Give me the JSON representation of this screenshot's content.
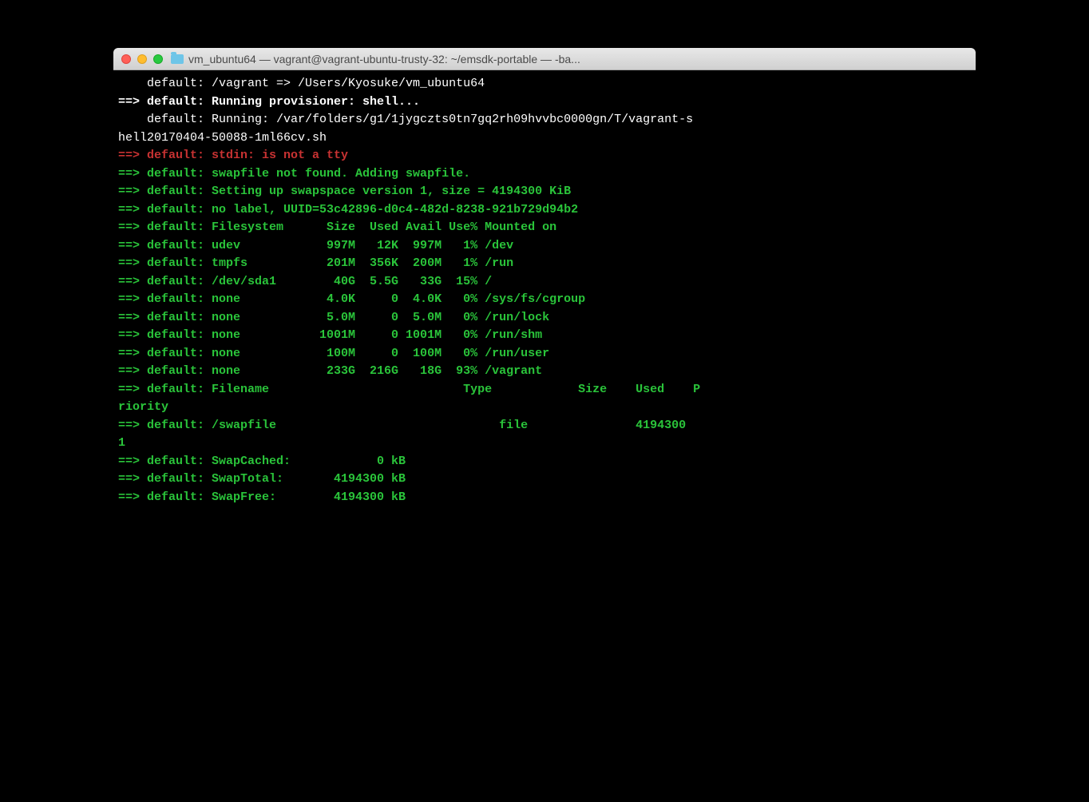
{
  "window": {
    "title": "vm_ubuntu64 — vagrant@vagrant-ubuntu-trusty-32: ~/emsdk-portable — -ba..."
  },
  "lines": [
    {
      "segments": [
        {
          "class": "white",
          "text": "    default: /vagrant => /Users/Kyosuke/vm_ubuntu64"
        }
      ]
    },
    {
      "segments": [
        {
          "class": "white bold",
          "text": "==> default: Running provisioner: shell..."
        }
      ]
    },
    {
      "segments": [
        {
          "class": "white",
          "text": "    default: Running: /var/folders/g1/1jygczts0tn7gq2rh09hvvbc0000gn/T/vagrant-s"
        }
      ]
    },
    {
      "segments": [
        {
          "class": "white",
          "text": "hell20170404-50088-1ml66cv.sh"
        }
      ]
    },
    {
      "segments": [
        {
          "class": "red bold",
          "text": "==> default: stdin: is not a tty"
        }
      ]
    },
    {
      "segments": [
        {
          "class": "green bold",
          "text": "==> default: swapfile not found. Adding swapfile."
        }
      ]
    },
    {
      "segments": [
        {
          "class": "green bold",
          "text": "==> default: Setting up swapspace version 1, size = 4194300 KiB"
        }
      ]
    },
    {
      "segments": [
        {
          "class": "green bold",
          "text": "==> default: no label, UUID=53c42896-d0c4-482d-8238-921b729d94b2"
        }
      ]
    },
    {
      "segments": [
        {
          "class": "green bold",
          "text": "==> default: Filesystem      Size  Used Avail Use% Mounted on"
        }
      ]
    },
    {
      "segments": [
        {
          "class": "green bold",
          "text": "==> default: udev            997M   12K  997M   1% /dev"
        }
      ]
    },
    {
      "segments": [
        {
          "class": "green bold",
          "text": "==> default: tmpfs           201M  356K  200M   1% /run"
        }
      ]
    },
    {
      "segments": [
        {
          "class": "green bold",
          "text": "==> default: /dev/sda1        40G  5.5G   33G  15% /"
        }
      ]
    },
    {
      "segments": [
        {
          "class": "green bold",
          "text": "==> default: none            4.0K     0  4.0K   0% /sys/fs/cgroup"
        }
      ]
    },
    {
      "segments": [
        {
          "class": "green bold",
          "text": "==> default: none            5.0M     0  5.0M   0% /run/lock"
        }
      ]
    },
    {
      "segments": [
        {
          "class": "green bold",
          "text": "==> default: none           1001M     0 1001M   0% /run/shm"
        }
      ]
    },
    {
      "segments": [
        {
          "class": "green bold",
          "text": "==> default: none            100M     0  100M   0% /run/user"
        }
      ]
    },
    {
      "segments": [
        {
          "class": "green bold",
          "text": "==> default: none            233G  216G   18G  93% /vagrant"
        }
      ]
    },
    {
      "segments": [
        {
          "class": "green bold",
          "text": "==> default: Filename\t\t\t\tType\t\tSize\tUsed\tP"
        }
      ]
    },
    {
      "segments": [
        {
          "class": "green bold",
          "text": "riority"
        }
      ]
    },
    {
      "segments": [
        {
          "class": "green bold",
          "text": "==> default: /swapfile                               file\t\t4194300\t"
        }
      ]
    },
    {
      "segments": [
        {
          "class": "green bold",
          "text": "1"
        }
      ]
    },
    {
      "segments": [
        {
          "class": "green bold",
          "text": "==> default: SwapCached:            0 kB"
        }
      ]
    },
    {
      "segments": [
        {
          "class": "green bold",
          "text": "==> default: SwapTotal:       4194300 kB"
        }
      ]
    },
    {
      "segments": [
        {
          "class": "green bold",
          "text": "==> default: SwapFree:        4194300 kB"
        }
      ]
    }
  ]
}
